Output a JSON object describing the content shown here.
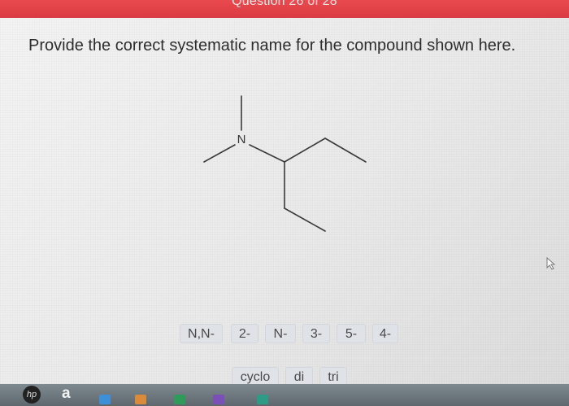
{
  "header": {
    "question_counter": "Question 26 of 28"
  },
  "question": {
    "prompt": "Provide the correct systematic name for the compound shown here.",
    "atom_label": "N"
  },
  "answer_tiles": {
    "row1": [
      "N,N-",
      "2-",
      "N-",
      "3-",
      "5-",
      "4-"
    ],
    "row2": [
      "cyclo",
      "di",
      "tri"
    ]
  },
  "taskbar": {
    "items": [
      {
        "name": "hp-logo",
        "label": "hp"
      },
      {
        "name": "amazon-icon",
        "label": "a"
      }
    ]
  },
  "colors": {
    "header_red": "#e2434a",
    "tile_bg": "#dfe3e8",
    "text": "#2d2d2d"
  }
}
